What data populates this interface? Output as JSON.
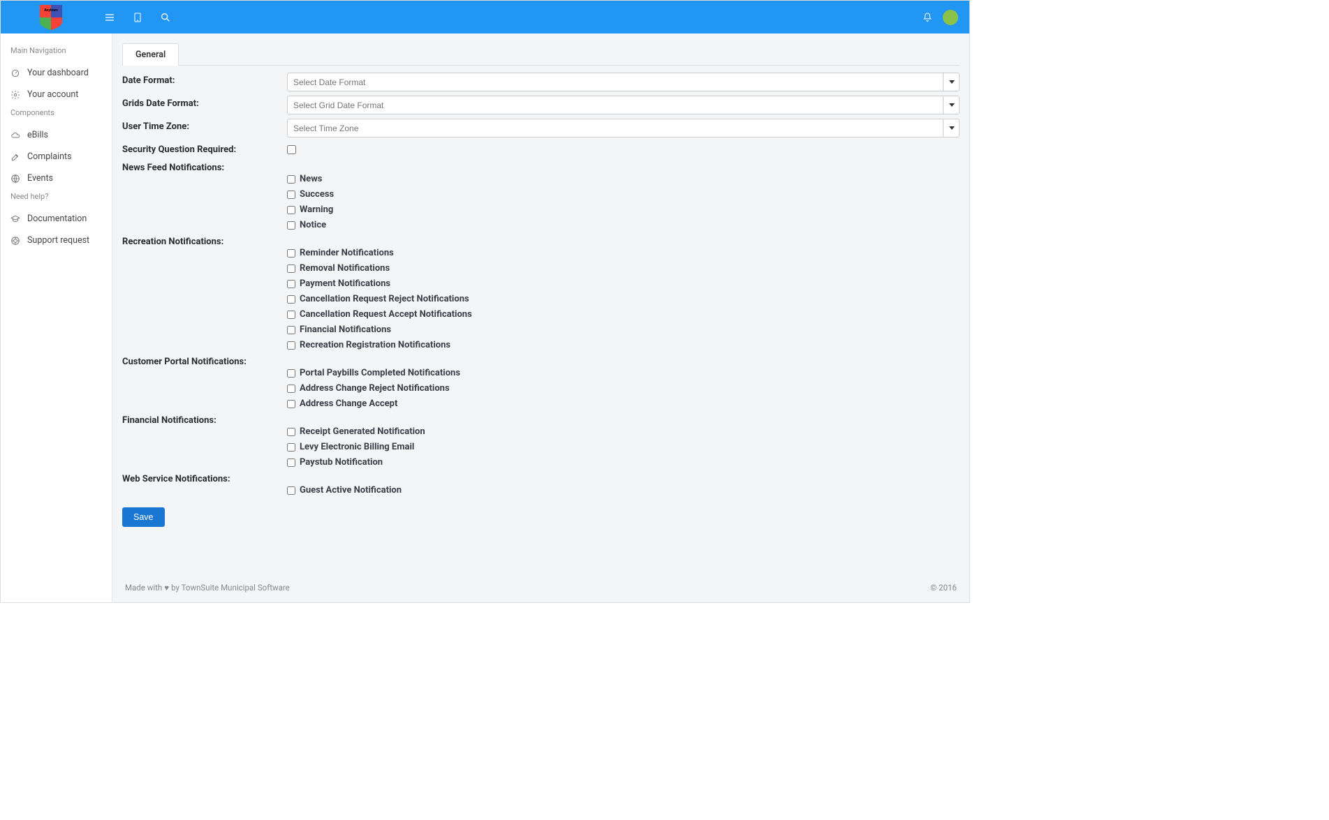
{
  "sidebar": {
    "sections": [
      {
        "title": "Main Navigation",
        "items": [
          {
            "label": "Your dashboard",
            "name": "sidebar-item-dashboard",
            "icon": "gauge"
          },
          {
            "label": "Your account",
            "name": "sidebar-item-account",
            "icon": "gear"
          }
        ]
      },
      {
        "title": "Components",
        "items": [
          {
            "label": "eBills",
            "name": "sidebar-item-ebills",
            "icon": "cloud"
          },
          {
            "label": "Complaints",
            "name": "sidebar-item-complaints",
            "icon": "edit"
          },
          {
            "label": "Events",
            "name": "sidebar-item-events",
            "icon": "globe"
          }
        ]
      },
      {
        "title": "Need help?",
        "items": [
          {
            "label": "Documentation",
            "name": "sidebar-item-documentation",
            "icon": "grad"
          },
          {
            "label": "Support request",
            "name": "sidebar-item-support",
            "icon": "life"
          }
        ]
      }
    ]
  },
  "tabs": {
    "general": "General"
  },
  "form": {
    "date_format_label": "Date Format:",
    "date_format_placeholder": "Select Date Format",
    "grid_date_format_label": "Grids Date Format:",
    "grid_date_format_placeholder": "Select Grid Date Format",
    "user_time_zone_label": "User Time Zone:",
    "user_time_zone_placeholder": "Select Time Zone",
    "security_question_label": "Security Question Required:",
    "groups": [
      {
        "title": "News Feed Notifications:",
        "items": [
          "News",
          "Success",
          "Warning",
          "Notice"
        ]
      },
      {
        "title": "Recreation Notifications:",
        "items": [
          "Reminder Notifications",
          "Removal Notifications",
          "Payment Notifications",
          "Cancellation Request Reject Notifications",
          "Cancellation Request Accept Notifications",
          "Financial Notifications",
          "Recreation Registration Notifications"
        ]
      },
      {
        "title": "Customer Portal Notifications:",
        "items": [
          "Portal Paybills Completed Notifications",
          "Address Change Reject Notifications",
          "Address Change Accept"
        ]
      },
      {
        "title": "Financial Notifications:",
        "items": [
          "Receipt Generated Notification",
          "Levy Electronic Billing Email",
          "Paystub Notification"
        ]
      },
      {
        "title": "Web Service Notifications:",
        "items": [
          "Guest Active Notification"
        ]
      }
    ],
    "save_label": "Save"
  },
  "footer": {
    "prefix": "Made with",
    "suffix": "by TownSuite Municipal Software",
    "copyright": "© 2016"
  }
}
